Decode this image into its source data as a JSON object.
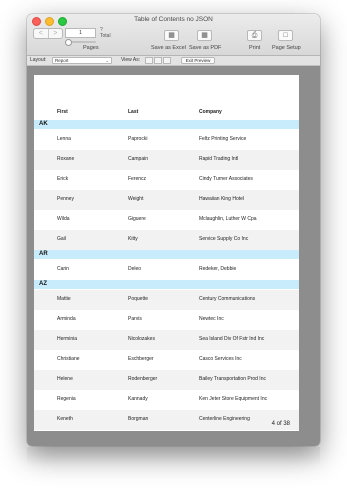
{
  "window": {
    "title": "Table of Contents no JSON"
  },
  "toolbar": {
    "nav_back": "<",
    "nav_forward": ">",
    "page_value": "1",
    "page_question": "?",
    "total_label": "Total",
    "pages_label": "Pages",
    "save_excel_label": "Save as Excel",
    "save_pdf_label": "Save as PDF",
    "print_label": "Print",
    "page_setup_label": "Page Setup"
  },
  "statusbar": {
    "layout_label": "Layout:",
    "layout_value": "Report",
    "view_as_label": "View As:",
    "exit_preview_label": "Exit Preview"
  },
  "report": {
    "headers": {
      "first": "First",
      "last": "Last",
      "company": "Company"
    },
    "groups": [
      {
        "state": "AK",
        "rows": [
          {
            "first": "Lenna",
            "last": "Paprocki",
            "company": "Feltz Printing Service"
          },
          {
            "first": "Roxane",
            "last": "Campain",
            "company": "Rapid Trading Intl"
          },
          {
            "first": "Erick",
            "last": "Ferencz",
            "company": "Cindy Turner Associates"
          },
          {
            "first": "Penney",
            "last": "Weight",
            "company": "Hawaiian King Hotel"
          },
          {
            "first": "Wilda",
            "last": "Giguere",
            "company": "Mclaughlin, Luther W Cpa"
          },
          {
            "first": "Gail",
            "last": "Kitty",
            "company": "Service Supply Co Inc"
          }
        ]
      },
      {
        "state": "AR",
        "rows": [
          {
            "first": "Carin",
            "last": "Deleo",
            "company": "Redeker, Debbie"
          }
        ]
      },
      {
        "state": "AZ",
        "rows": [
          {
            "first": "Mattie",
            "last": "Poquette",
            "company": "Century Communications"
          },
          {
            "first": "Arminda",
            "last": "Parvis",
            "company": "Newtec Inc"
          },
          {
            "first": "Herminia",
            "last": "Nicolozakes",
            "company": "Sea Island Div Of Fstr Ind Inc"
          },
          {
            "first": "Christiane",
            "last": "Eschberger",
            "company": "Casco Services Inc"
          },
          {
            "first": "Helene",
            "last": "Rodenberger",
            "company": "Bailey Transportation Prod Inc"
          },
          {
            "first": "Regenia",
            "last": "Kannady",
            "company": "Ken Jeter Store Equipment Inc"
          },
          {
            "first": "Keneth",
            "last": "Borgman",
            "company": "Centerline Engineering"
          }
        ]
      }
    ],
    "page_indicator": "4 of 38"
  }
}
